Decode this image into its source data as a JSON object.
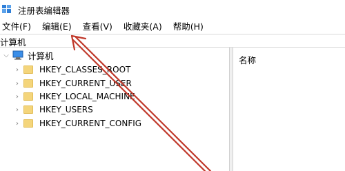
{
  "window": {
    "title": "注册表编辑器"
  },
  "menu": {
    "items": [
      "文件(F)",
      "编辑(E)",
      "查看(V)",
      "收藏夹(A)",
      "帮助(H)"
    ]
  },
  "address": {
    "path": "计算机"
  },
  "tree": {
    "root": {
      "label": "计算机",
      "icon": "computer-icon"
    },
    "children": [
      {
        "label": "HKEY_CLASSES_ROOT"
      },
      {
        "label": "HKEY_CURRENT_USER"
      },
      {
        "label": "HKEY_LOCAL_MACHINE"
      },
      {
        "label": "HKEY_USERS"
      },
      {
        "label": "HKEY_CURRENT_CONFIG"
      }
    ]
  },
  "list": {
    "columns": [
      "名称"
    ]
  },
  "colors": {
    "annotation_arrow": "#c0392b",
    "folder": "#f4d57b"
  }
}
